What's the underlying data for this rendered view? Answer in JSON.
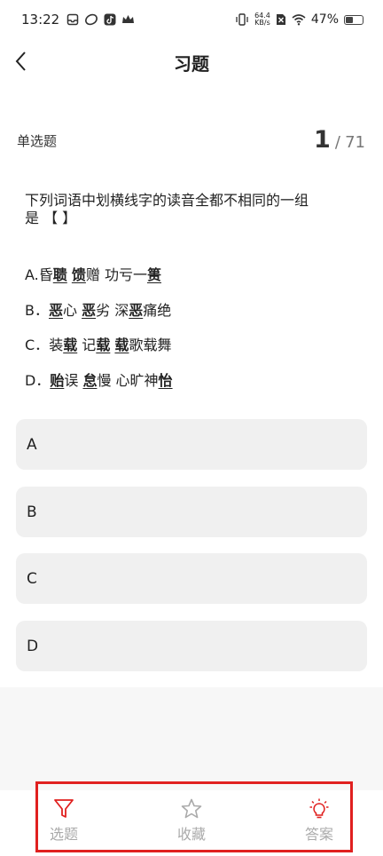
{
  "status": {
    "time": "13:22",
    "net_speed_value": "64.4",
    "net_speed_unit": "KB/s",
    "battery": "47%",
    "battery_level": 0.47
  },
  "header": {
    "title": "习题"
  },
  "question": {
    "type_label": "单选题",
    "current": "1",
    "separator": "/",
    "total": "71",
    "stem_line1": "下列词语中划横线字的读音全都不相同的一组",
    "stem_line2": "是 【 】",
    "options": [
      {
        "prefix": "A.",
        "segments": [
          {
            "t": "昏",
            "u": false
          },
          {
            "t": "聩",
            "u": true
          },
          {
            "t": " ",
            "u": false
          },
          {
            "t": "馈",
            "u": true
          },
          {
            "t": "赠 功亏一",
            "u": false
          },
          {
            "t": "篑",
            "u": true
          }
        ]
      },
      {
        "prefix": "B．",
        "segments": [
          {
            "t": "恶",
            "u": true
          },
          {
            "t": "心 ",
            "u": false
          },
          {
            "t": "恶",
            "u": true
          },
          {
            "t": "劣 深",
            "u": false
          },
          {
            "t": "恶",
            "u": true
          },
          {
            "t": "痛绝",
            "u": false
          }
        ]
      },
      {
        "prefix": "C．",
        "segments": [
          {
            "t": "装",
            "u": false
          },
          {
            "t": "载",
            "u": true
          },
          {
            "t": " 记",
            "u": false
          },
          {
            "t": "载",
            "u": true
          },
          {
            "t": " ",
            "u": false
          },
          {
            "t": "载",
            "u": true
          },
          {
            "t": "歌载舞",
            "u": false
          }
        ]
      },
      {
        "prefix": "D．",
        "segments": [
          {
            "t": "贻",
            "u": true
          },
          {
            "t": "误 ",
            "u": false
          },
          {
            "t": "怠",
            "u": true
          },
          {
            "t": "慢 心旷神",
            "u": false
          },
          {
            "t": "怡",
            "u": true
          }
        ]
      }
    ]
  },
  "answers": [
    "A",
    "B",
    "C",
    "D"
  ],
  "tabs": [
    {
      "label": "选题",
      "icon": "filter-icon",
      "color": "#e0201f"
    },
    {
      "label": "收藏",
      "icon": "star-icon",
      "color": "#aaaaaa"
    },
    {
      "label": "答案",
      "icon": "lightbulb-icon",
      "color": "#e0201f"
    }
  ],
  "highlight_color": "#e0201f"
}
